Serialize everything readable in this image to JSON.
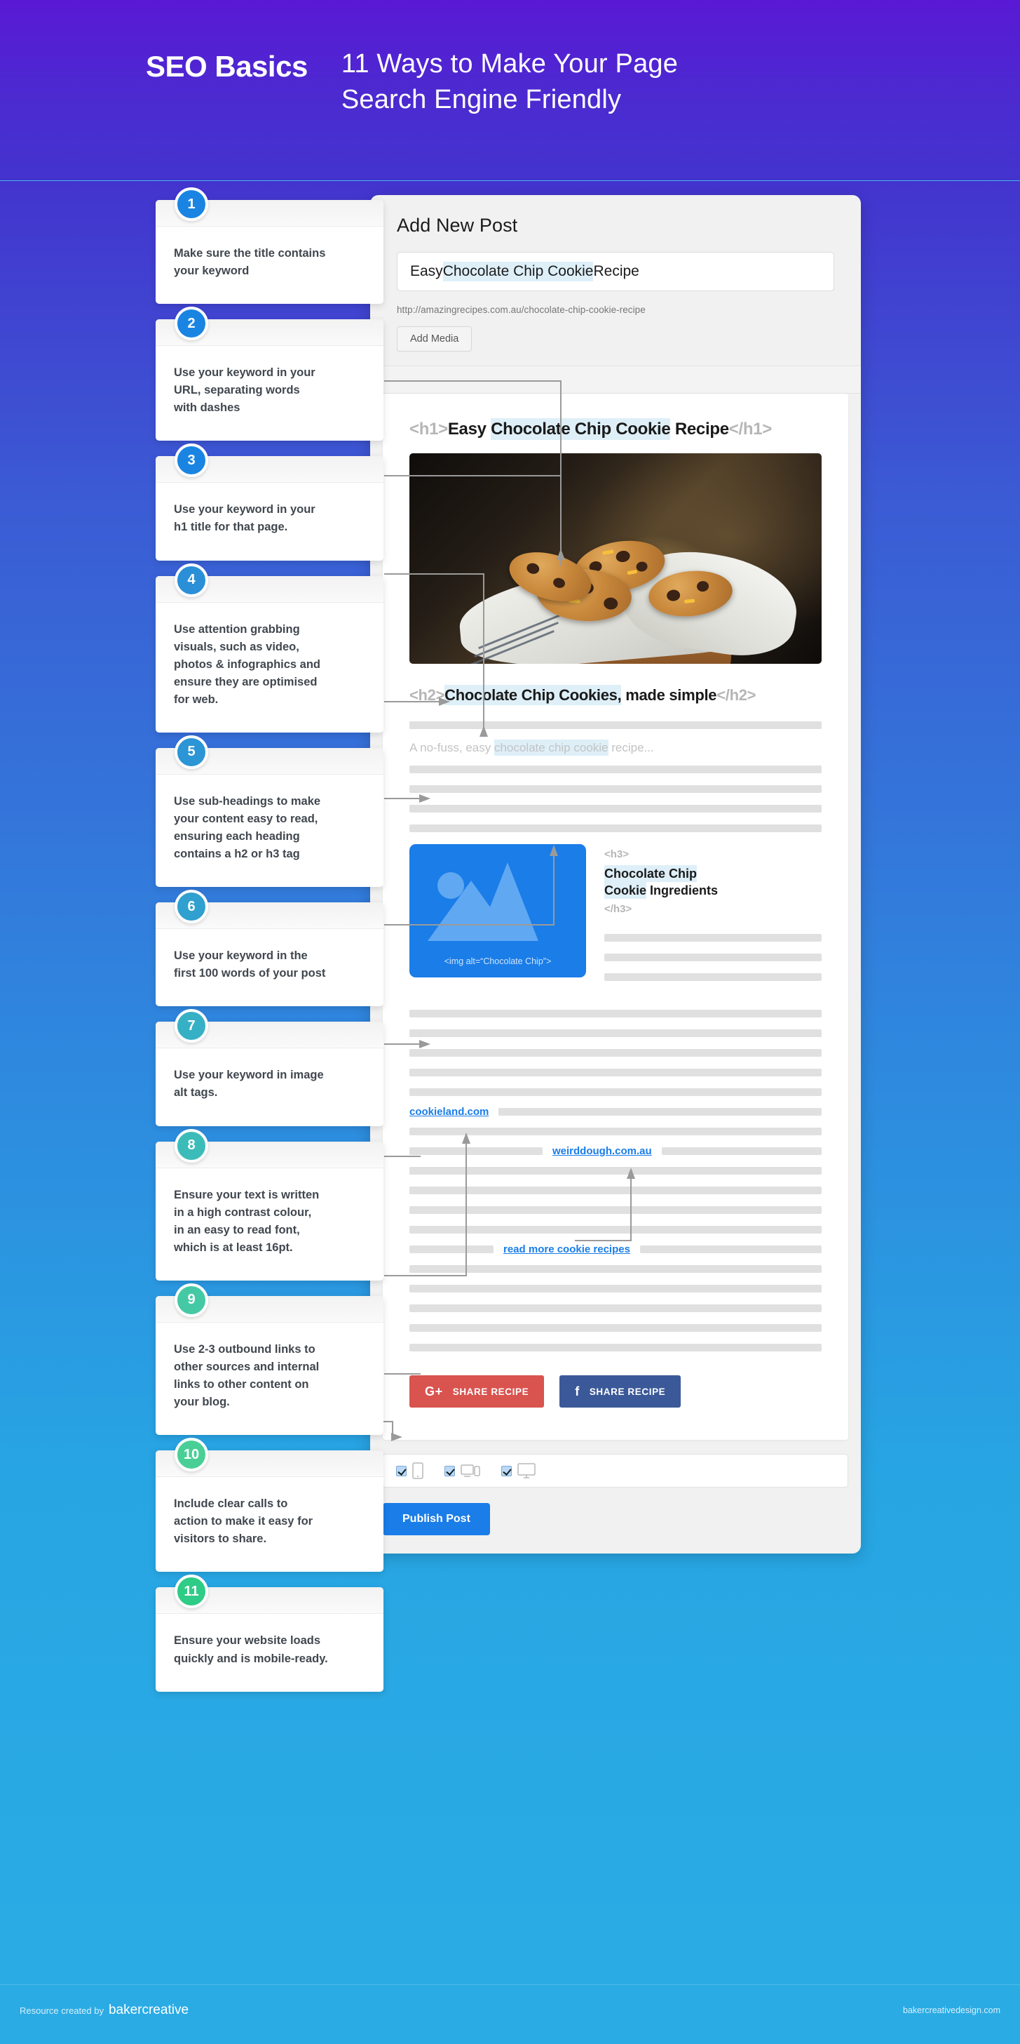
{
  "header": {
    "brand": "SEO Basics",
    "title": "11 Ways to Make Your Page\nSearch Engine Friendly"
  },
  "tips": [
    {
      "number": "1",
      "text": "Make sure the title contains\nyour keyword",
      "color": "#1a84e2"
    },
    {
      "number": "2",
      "text": "Use your keyword in your\nURL, separating words\nwith dashes",
      "color": "#1a84e2"
    },
    {
      "number": "3",
      "text": "Use your keyword in your\nh1 title for that page.",
      "color": "#1a84e2"
    },
    {
      "number": "4",
      "text": "Use attention grabbing\nvisuals, such as video,\nphotos & infographics and\nensure they are optimised\nfor web.",
      "color": "#2b8fd8"
    },
    {
      "number": "5",
      "text": "Use sub-headings to make\nyour content easy to read,\nensuring each heading\ncontains a h2 or h3 tag",
      "color": "#2b95d5"
    },
    {
      "number": "6",
      "text": "Use your keyword in the\nfirst 100 words of your post",
      "color": "#2fa0cf"
    },
    {
      "number": "7",
      "text": "Use your keyword in image\nalt tags.",
      "color": "#36b0c4"
    },
    {
      "number": "8",
      "text": "Ensure your text is written\nin a high contrast colour,\nin an easy to read font,\nwhich is at least 16pt.",
      "color": "#3cbcb8"
    },
    {
      "number": "9",
      "text": "Use 2-3 outbound links to\nother sources and internal\nlinks to other content on\nyour blog.",
      "color": "#45c9a4"
    },
    {
      "number": "10",
      "text": "Include clear calls to\naction to make it easy for\nvisitors to share.",
      "color": "#49cf96"
    },
    {
      "number": "11",
      "text": "Ensure your website loads\nquickly and is mobile-ready.",
      "color": "#2ecc87"
    }
  ],
  "editor": {
    "page_title": "Add New Post",
    "post_title_prefix": "Easy ",
    "post_title_keyword": "Chocolate Chip Cookie",
    "post_title_suffix": " Recipe",
    "permalink": "http://amazingrecipes.com.au/chocolate-chip-cookie-recipe",
    "add_media_label": "Add Media",
    "publish_label": "Publish Post"
  },
  "content": {
    "h1_open": "<h1>",
    "h1_prefix": "Easy ",
    "h1_keyword": "Chocolate Chip Cookie",
    "h1_suffix": " Recipe",
    "h1_close": "</h1>",
    "photo_alt": "Chocolate chip cookies in a cloth-lined wooden bowl",
    "h2_open": "<h2>",
    "h2_keyword": "Chocolate Chip Cookies,",
    "h2_suffix": " made simple",
    "h2_close": "</h2>",
    "intro_prefix": "A no-fuss, easy ",
    "intro_keyword": "chocolate chip cookie",
    "intro_suffix": " recipe...",
    "img_alt_code": "<img alt=“Chocolate Chip”>",
    "h3_open": "<h3>",
    "h3_keyword_line1": "Chocolate Chip",
    "h3_keyword_line2": "Cookie",
    "h3_rest": " Ingredients",
    "h3_close": "</h3>",
    "link_outbound_1": "cookieland.com",
    "link_outbound_2": "weirddough.com.au",
    "link_internal": "read more cookie recipes",
    "share_google_label": "SHARE RECIPE",
    "share_google_icon": "G+",
    "share_facebook_label": "SHARE RECIPE",
    "share_facebook_icon": "f",
    "devices": [
      "mobile-icon",
      "tablet-icon",
      "desktop-icon"
    ]
  },
  "footer": {
    "credit_prefix": "Resource created by",
    "credit_brand": "bakercreative",
    "site": "bakercreativedesign.com"
  },
  "colors": {
    "hero_top": "#5919d4",
    "hero_bottom": "#4334ce",
    "band_bottom": "#2aabe4",
    "keyword_highlight": "#deeff8",
    "link_blue": "#1a7de8",
    "google_red": "#d9534f",
    "facebook_blue": "#3b5998"
  }
}
